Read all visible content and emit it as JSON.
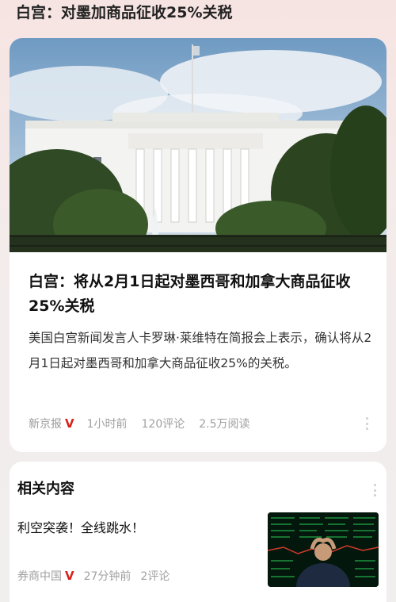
{
  "header": {
    "title": "白宫：对墨加商品征收25%关税"
  },
  "article": {
    "image_alt": "White House",
    "title": "白宫：将从2月1日起对墨西哥和加拿大商品征收25%关税",
    "summary": "美国白宫新闻发言人卡罗琳·莱维特在简报会上表示，确认将从2月1日起对墨西哥和加拿大商品征收25%的关税。",
    "source": "新京报",
    "verified_badge": "V",
    "time": "1小时前",
    "comments": "120评论",
    "reads": "2.5万阅读"
  },
  "related": {
    "heading": "相关内容",
    "items": [
      {
        "title": "利空突袭！全线跳水！",
        "source": "券商中国",
        "verified_badge": "V",
        "time": "27分钟前",
        "comments": "2评论"
      }
    ]
  },
  "colors": {
    "verified": "#d8231d",
    "meta": "#a0a0a0",
    "card": "#ffffff"
  },
  "icons": {
    "more": "more-vertical-icon"
  }
}
